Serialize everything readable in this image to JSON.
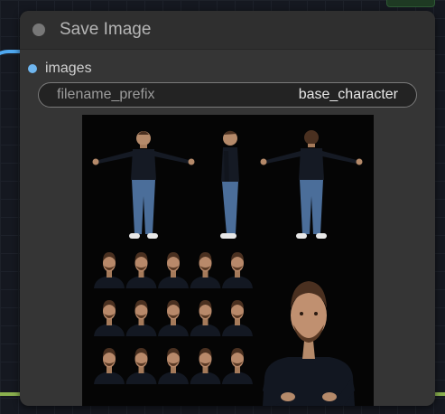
{
  "node": {
    "title": "Save Image",
    "input_label": "images",
    "widget_name": "filename_prefix",
    "widget_value": "base_character"
  },
  "colors": {
    "node_body": "#353535",
    "input_slot": "#6fb6ef",
    "wire_blue": "#4fa8f0",
    "wire_green": "#8ab04e"
  },
  "preview": {
    "content": "character-reference-sheet",
    "headshot_rows": 3,
    "headshot_cols": 5
  }
}
